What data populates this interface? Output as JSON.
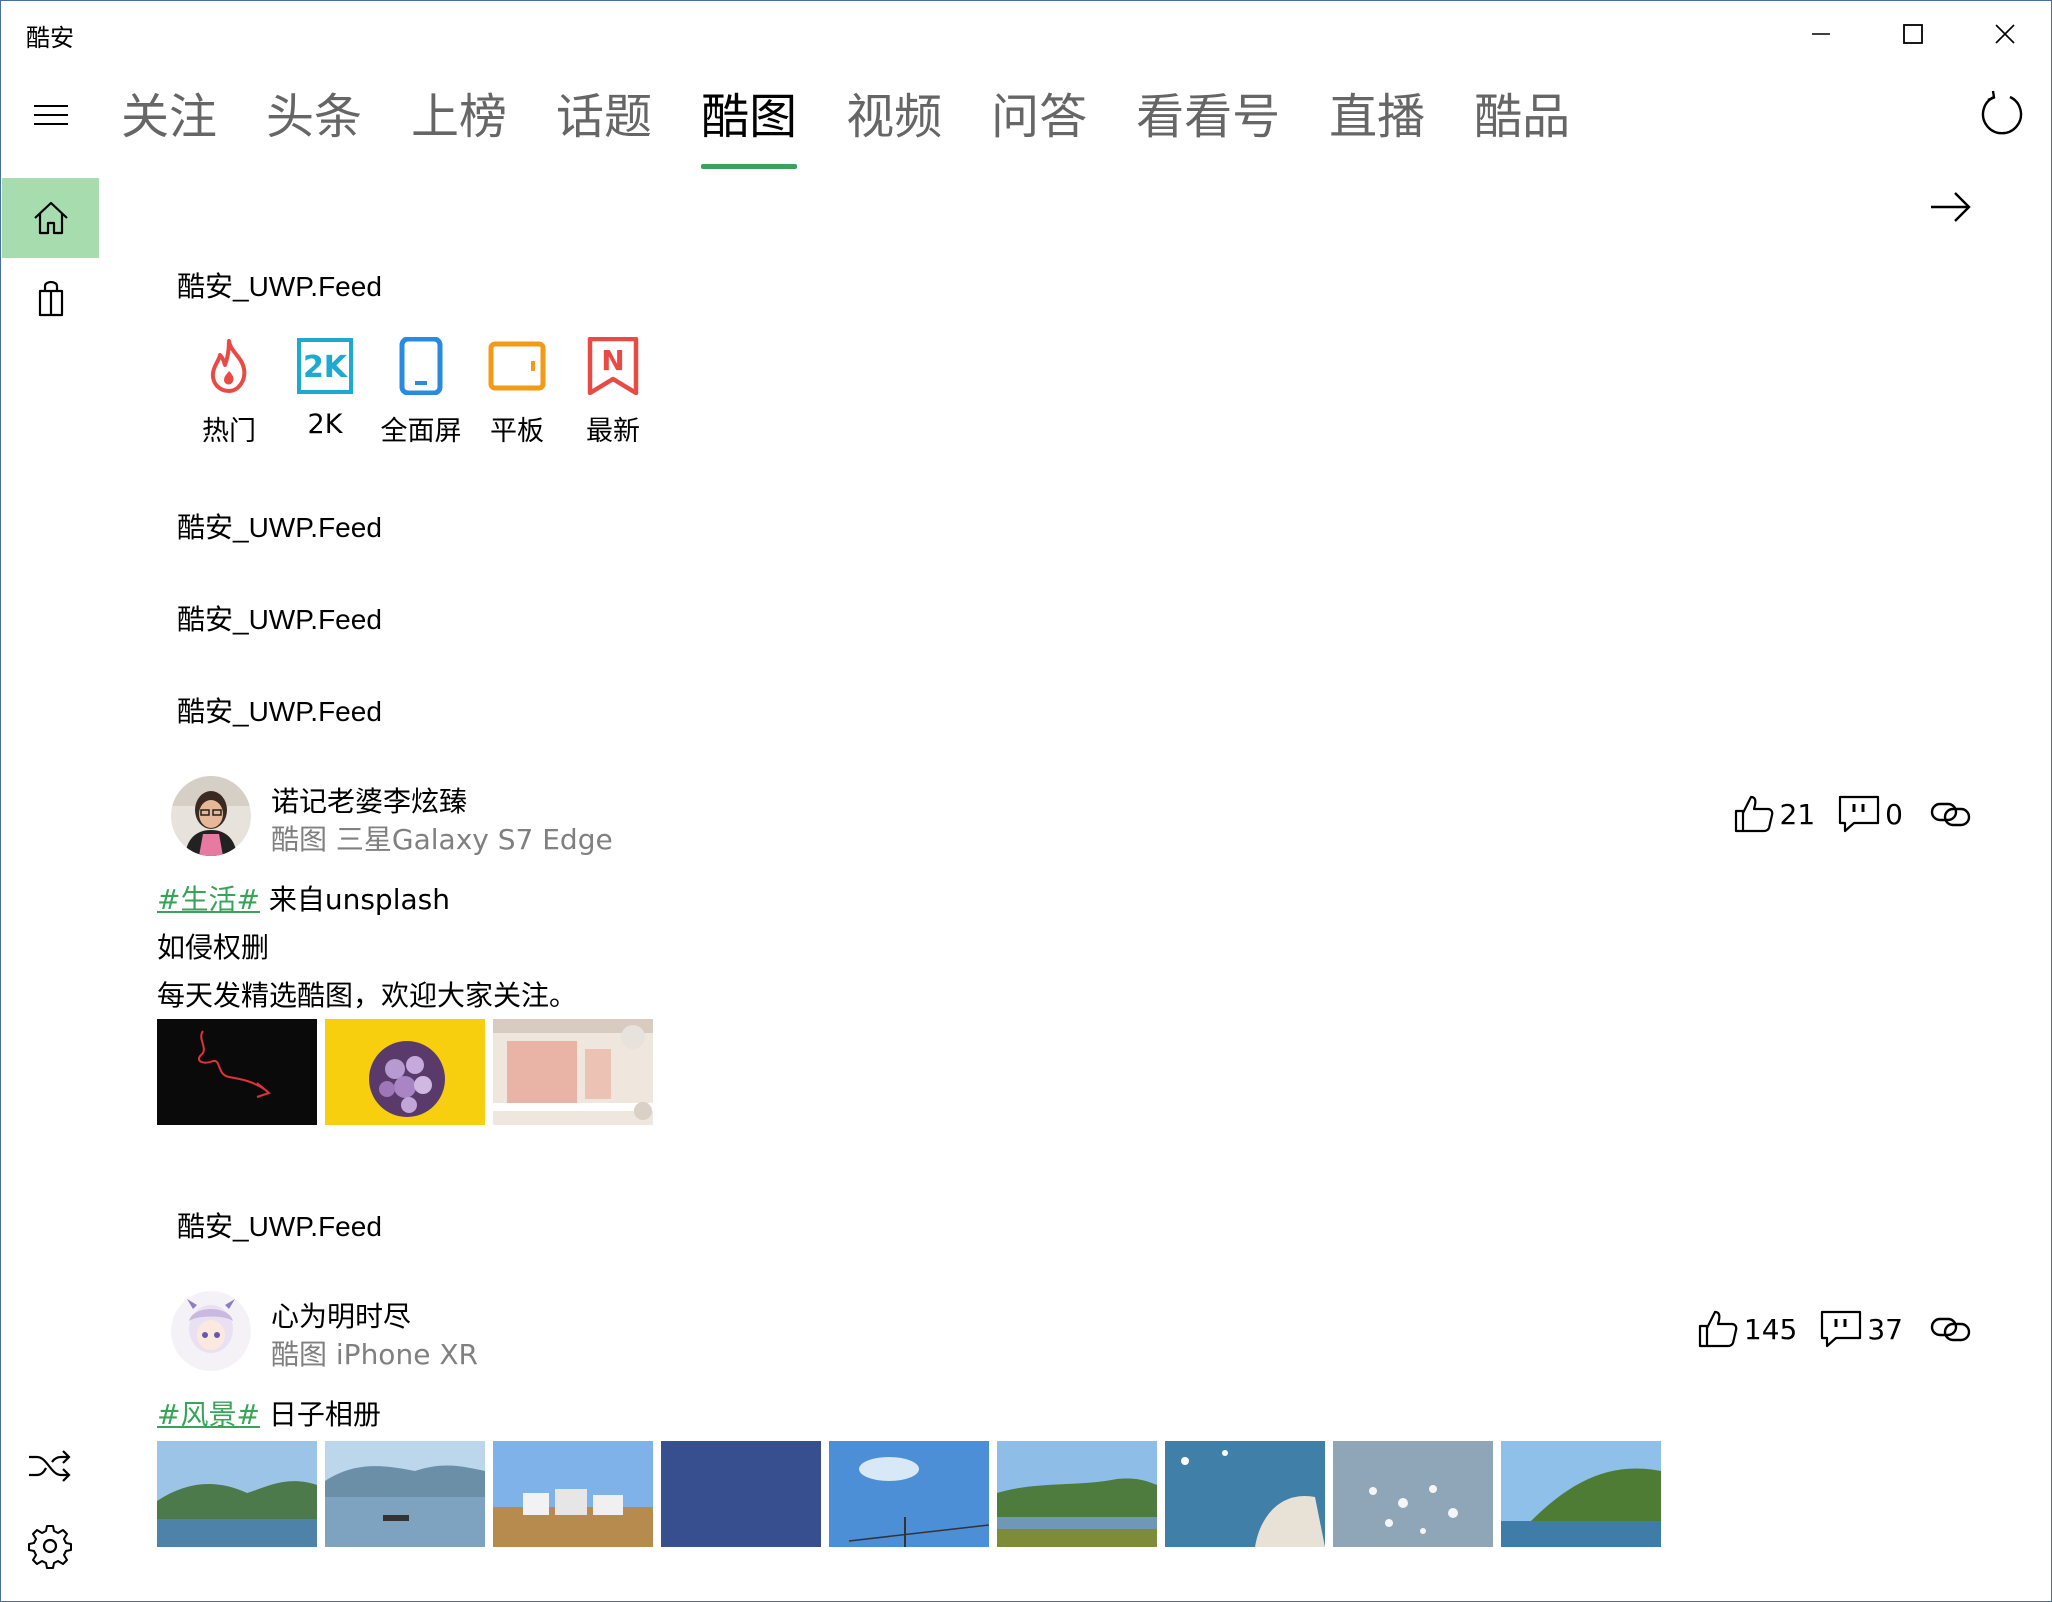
{
  "app": {
    "title": "酷安"
  },
  "tabs": [
    {
      "label": "关注"
    },
    {
      "label": "头条"
    },
    {
      "label": "上榜"
    },
    {
      "label": "话题"
    },
    {
      "label": "酷图",
      "active": true
    },
    {
      "label": "视频"
    },
    {
      "label": "问答"
    },
    {
      "label": "看看号"
    },
    {
      "label": "直播"
    },
    {
      "label": "酷品"
    }
  ],
  "feeds": {
    "f1": "酷安_UWP.Feed",
    "f2": "酷安_UWP.Feed",
    "f3": "酷安_UWP.Feed",
    "f4": "酷安_UWP.Feed",
    "f5": "酷安_UWP.Feed"
  },
  "categories": [
    {
      "label": "热门",
      "icon": "fire-icon",
      "color": "#e94b44"
    },
    {
      "label": "2K",
      "icon": "2k-icon",
      "color": "#1fa8d0"
    },
    {
      "label": "全面屏",
      "icon": "phone-icon",
      "color": "#2a8ae0"
    },
    {
      "label": "平板",
      "icon": "tablet-icon",
      "color": "#f39a16"
    },
    {
      "label": "最新",
      "icon": "new-bookmark-icon",
      "color": "#e94b44"
    }
  ],
  "posts": [
    {
      "user": "诺记老婆李炫臻",
      "meta": "酷图 三星Galaxy S7 Edge",
      "likes": "21",
      "comments": "0",
      "tag": "#生活#",
      "line1": " 来自unsplash",
      "line2": "如侵权删",
      "line3": "每天发精选酷图，欢迎大家关注。"
    },
    {
      "user": "心为明时尽",
      "meta": "酷图 iPhone XR",
      "likes": "145",
      "comments": "37",
      "tag": "#风景#",
      "line1": " 日子相册"
    }
  ],
  "colors": {
    "accent": "#3aa35a",
    "nav_active": "#a6dcae",
    "muted": "#808080"
  }
}
